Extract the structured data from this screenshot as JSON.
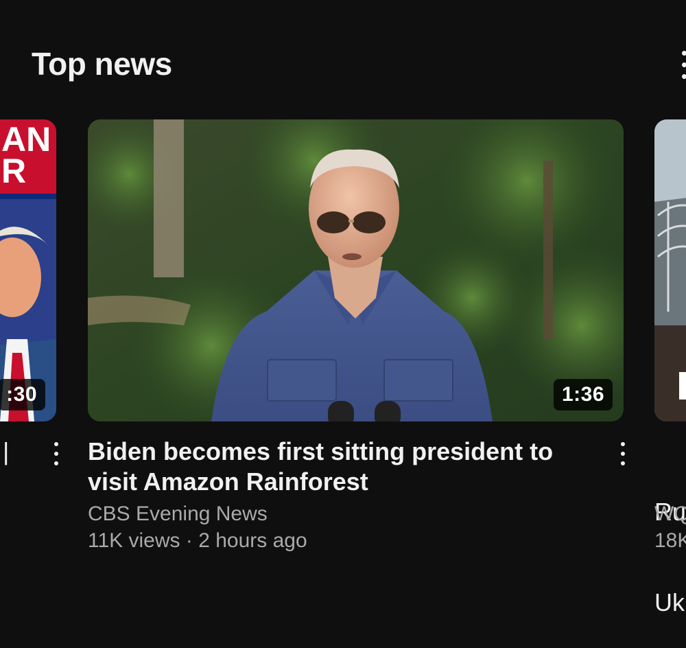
{
  "section": {
    "title": "Top news",
    "menu_icon": "vertical-ellipsis-icon"
  },
  "cards": {
    "left": {
      "banner_text_line1": "AN",
      "banner_text_line2": "R",
      "duration": ":30",
      "title_fragment": "|"
    },
    "main": {
      "duration": "1:36",
      "title": "Biden becomes first sitting president to visit Amazon Rainforest",
      "channel": "CBS Evening News",
      "views": "11K views",
      "separator": "·",
      "age": "2 hours ago"
    },
    "right": {
      "title_line1": "Ru",
      "title_line2": "Uk",
      "channel": "WQ",
      "views": "18K"
    }
  },
  "colors": {
    "background": "#0f0f0f",
    "primary_text": "#f1f1f1",
    "secondary_text": "#aaaaaa",
    "banner_red": "#c8102e"
  }
}
